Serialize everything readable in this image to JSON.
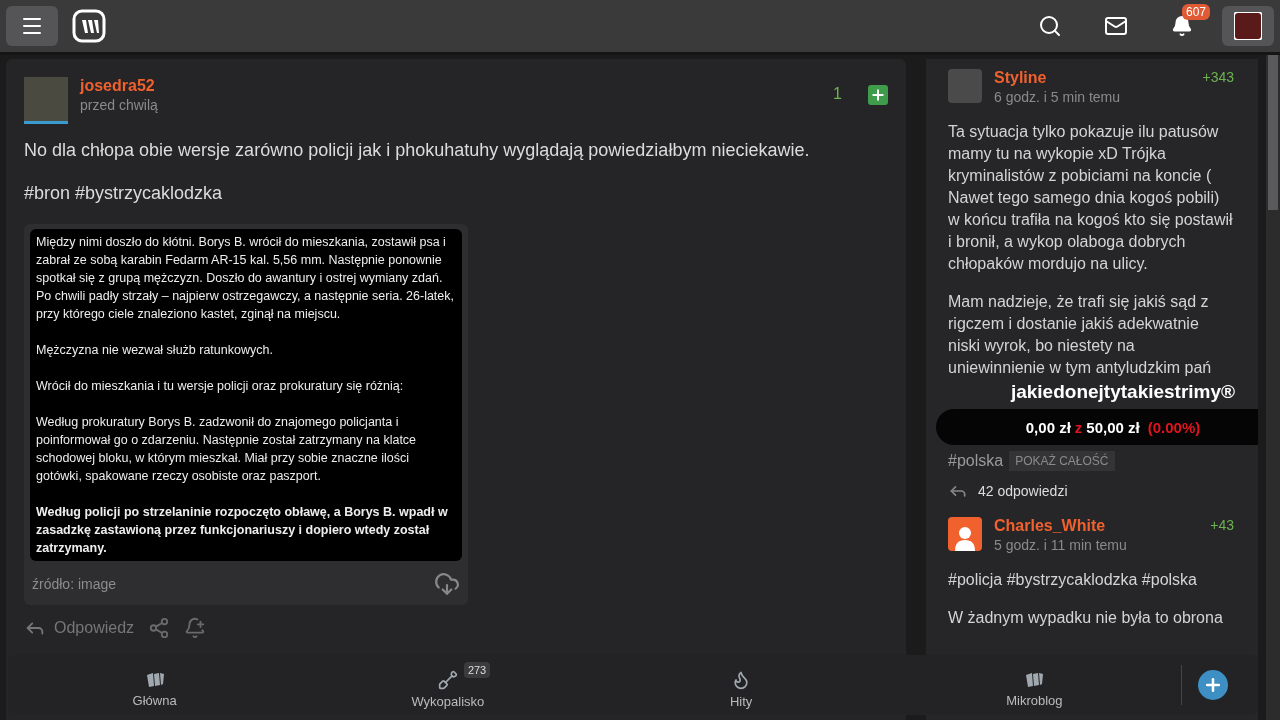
{
  "topbar": {
    "notifications": "607"
  },
  "post": {
    "author": "josedra52",
    "time": "przed chwilą",
    "votes": "1",
    "text": "No dla chłopa obie wersje zarówno policji jak i phokuhatuhy wyglądają powiedziałbym nieciekawie.",
    "tags": "#bron #bystrzycaklodzka",
    "embed": {
      "paragraphs": [
        {
          "text": "Między nimi doszło do kłótni. Borys B. wrócił do mieszkania, zostawił psa i zabrał ze sobą karabin Fedarm AR-15 kal. 5,56 mm. Następnie ponownie spotkał się z grupą mężczyzn. Doszło do awantury i ostrej wymiany zdań. Po chwili padły strzały – najpierw ostrzegawczy, a następnie seria. 26-latek, przy którego ciele znaleziono kastet, zginął na miejscu.",
          "bold": false
        },
        {
          "text": "Mężczyzna nie wezwał służb ratunkowych.",
          "bold": false
        },
        {
          "text": "Wrócił do mieszkania i tu wersje policji oraz prokuratury się różnią:",
          "bold": false
        },
        {
          "text": "Według prokuratury Borys B. zadzwonił do znajomego policjanta i poinformował go o zdarzeniu. Następnie został zatrzymany na klatce schodowej bloku, w którym mieszkał. Miał przy sobie znaczne ilości gotówki, spakowane rzeczy osobiste oraz paszport.",
          "bold": false
        },
        {
          "text": "Według policji po strzelaninie rozpoczęto obławę, a Borys B. wpadł w zasadzkę zastawioną przez funkcjonariuszy i dopiero wtedy został zatrzymany.",
          "bold": true
        }
      ],
      "source": "źródło: image"
    },
    "reply": "Odpowiedz"
  },
  "sidebar": {
    "entries": [
      {
        "author": "Styline",
        "kind": "photo",
        "time": "6 godz. i 5 min temu",
        "votes": "+343",
        "paragraphs": [
          "Ta sytuacja tylko pokazuje ilu patusów mamy tu na wykopie xD Trójka kryminalistów z pobiciami na koncie ( Nawet tego samego dnia kogoś pobili) w końcu trafiła na kogoś kto się postawił i bronił, a wykop olaboga dobrych chłopaków mordujo na ulicy.",
          "Mam nadzieje, że trafi się jakiś sąd z rigczem i dostanie jakiś adekwatnie niski wyrok, bo niestety na uniewinnienie w tym antyludzkim pań"
        ],
        "tags": "#polska",
        "show_more": "POKAŻ CAŁOŚĆ",
        "replies": "42 odpowiedzi"
      },
      {
        "author": "Charles_White",
        "kind": "default",
        "time": "5 godz. i 11 min temu",
        "votes": "+43",
        "paragraphs": [
          "#policja #bystrzycaklodzka #polska",
          "W żadnym wypadku nie była to obrona"
        ]
      }
    ]
  },
  "overlay": {
    "title": "jakiedonejtytakiestrimy®",
    "raised": "0,00 zł",
    "separator": "z",
    "goal": "50,00 zł",
    "percent": "(0.00%)"
  },
  "bottom_nav": {
    "items": [
      {
        "kind": "home",
        "label": "Główna"
      },
      {
        "kind": "dig",
        "label": "Wykopalisko",
        "badge": "273"
      },
      {
        "kind": "hot",
        "label": "Hity"
      },
      {
        "kind": "micro",
        "label": "Mikroblog"
      }
    ]
  }
}
